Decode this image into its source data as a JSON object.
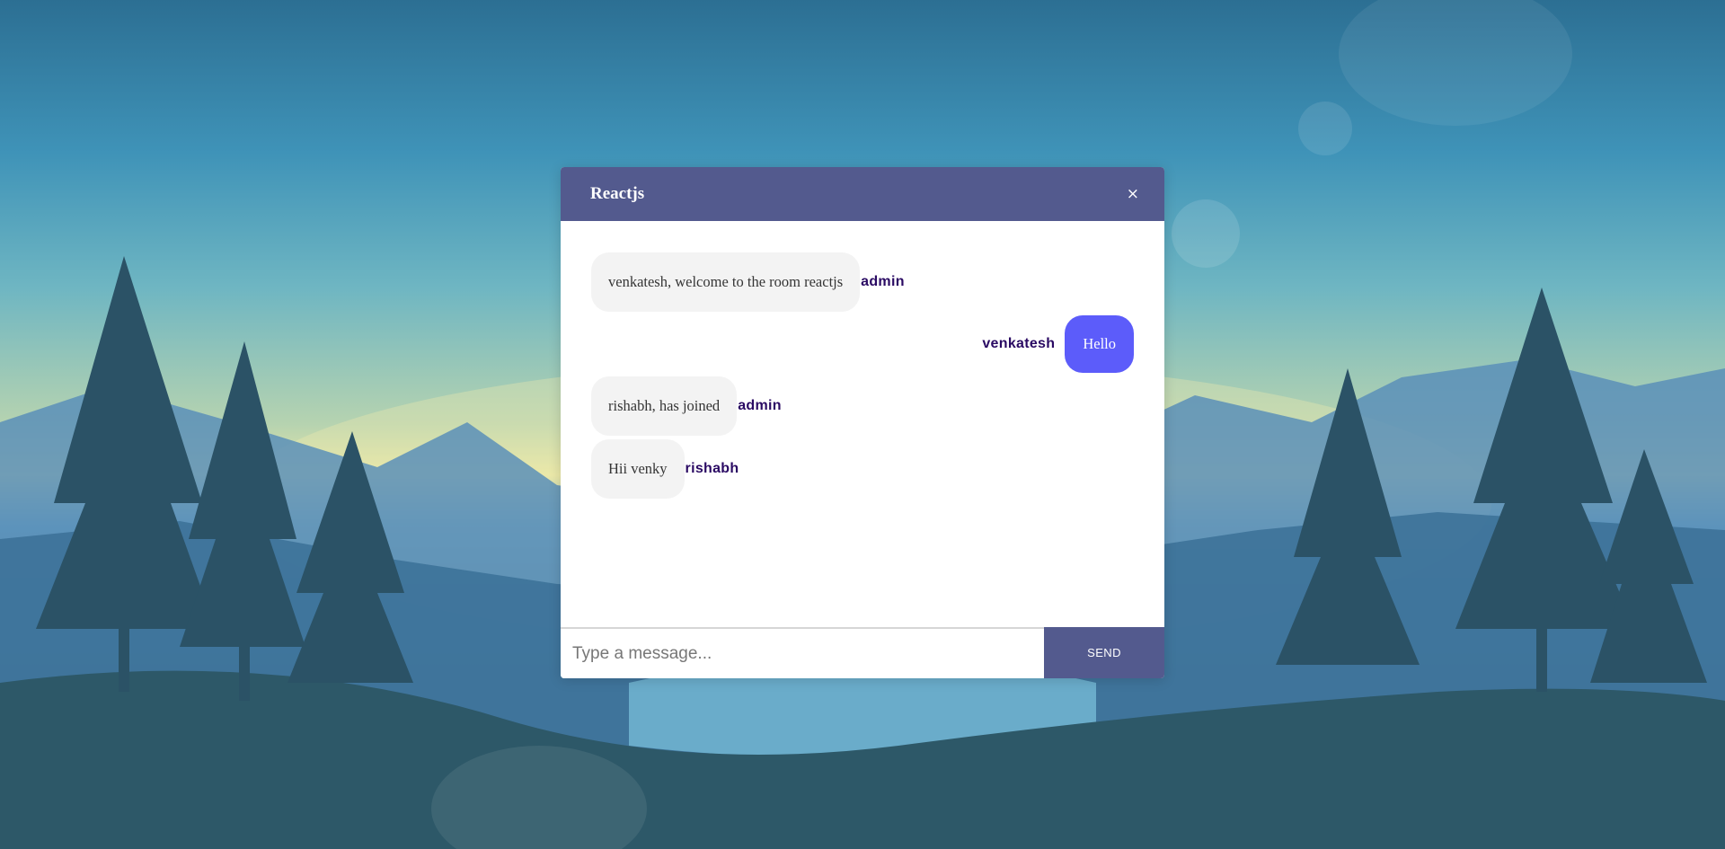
{
  "room": {
    "name": "Reactjs",
    "close_label": "×"
  },
  "messages": [
    {
      "text": "venkatesh, welcome to the room reactjs",
      "sender": "admin",
      "own": false
    },
    {
      "text": "Hello",
      "sender": "venkatesh",
      "own": true
    },
    {
      "text": "rishabh, has joined",
      "sender": "admin",
      "own": false
    },
    {
      "text": "Hii venky",
      "sender": "rishabh",
      "own": false
    }
  ],
  "composer": {
    "placeholder": "Type a message...",
    "value": "",
    "send_label": "SEND"
  },
  "colors": {
    "header": "#535a8e",
    "own_bubble": "#5c5cfa",
    "other_bubble": "#f3f3f3",
    "sender_name": "#2a0a63"
  }
}
